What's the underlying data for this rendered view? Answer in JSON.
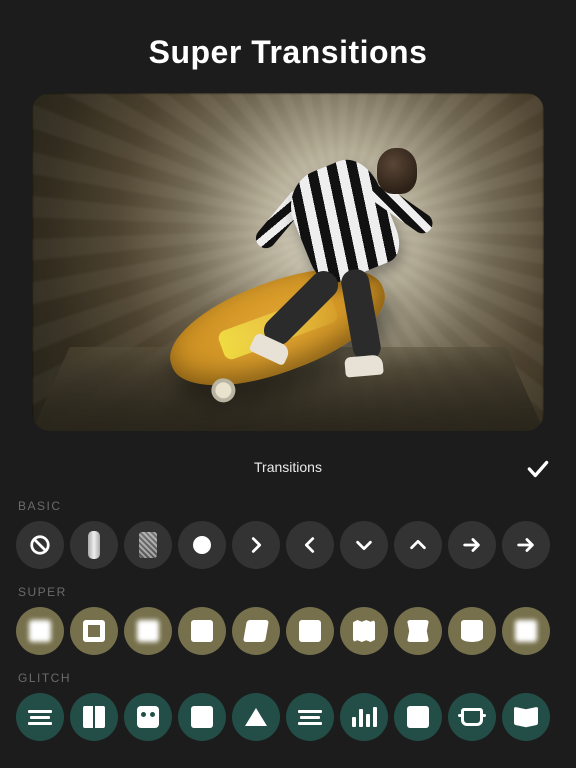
{
  "title": "Super Transitions",
  "panel": {
    "title": "Transitions"
  },
  "sections": {
    "basic": {
      "label": "BASIC"
    },
    "super": {
      "label": "SUPER"
    },
    "glitch": {
      "label": "GLITCH"
    }
  },
  "basic_items": [
    {
      "name": "none",
      "icon": "ban"
    },
    {
      "name": "wipe",
      "icon": "pill"
    },
    {
      "name": "dissolve",
      "icon": "dither"
    },
    {
      "name": "fade",
      "icon": "dot"
    },
    {
      "name": "slide-right",
      "icon": "chev-right"
    },
    {
      "name": "slide-left",
      "icon": "chev-left"
    },
    {
      "name": "slide-down",
      "icon": "chev-down"
    },
    {
      "name": "slide-up",
      "icon": "chev-up"
    },
    {
      "name": "push-right",
      "icon": "arrow-right"
    },
    {
      "name": "push-right-2",
      "icon": "arrow-right"
    }
  ],
  "super_items": [
    {
      "name": "zoom-blur-1",
      "icon": "sq-blur"
    },
    {
      "name": "frame",
      "icon": "sq-ring"
    },
    {
      "name": "zoom-blur-2",
      "icon": "sq-blur"
    },
    {
      "name": "pop",
      "icon": "sq"
    },
    {
      "name": "skew",
      "icon": "sq-tilt"
    },
    {
      "name": "card",
      "icon": "sq"
    },
    {
      "name": "wave",
      "icon": "sq-wav"
    },
    {
      "name": "squeeze",
      "icon": "sq-vsq"
    },
    {
      "name": "bend",
      "icon": "sq-hcurve"
    },
    {
      "name": "soft",
      "icon": "sq-blur"
    }
  ],
  "glitch_items": [
    {
      "name": "scanlines",
      "icon": "g-bars"
    },
    {
      "name": "split",
      "icon": "g-split"
    },
    {
      "name": "pixel-face",
      "icon": "g-face"
    },
    {
      "name": "block",
      "icon": "g-sheet"
    },
    {
      "name": "prism",
      "icon": "g-tri"
    },
    {
      "name": "static",
      "icon": "g-bars2"
    },
    {
      "name": "bars",
      "icon": "g-eq"
    },
    {
      "name": "tear",
      "icon": "g-sheet"
    },
    {
      "name": "vhs",
      "icon": "g-box"
    },
    {
      "name": "flip",
      "icon": "g-flip"
    }
  ]
}
